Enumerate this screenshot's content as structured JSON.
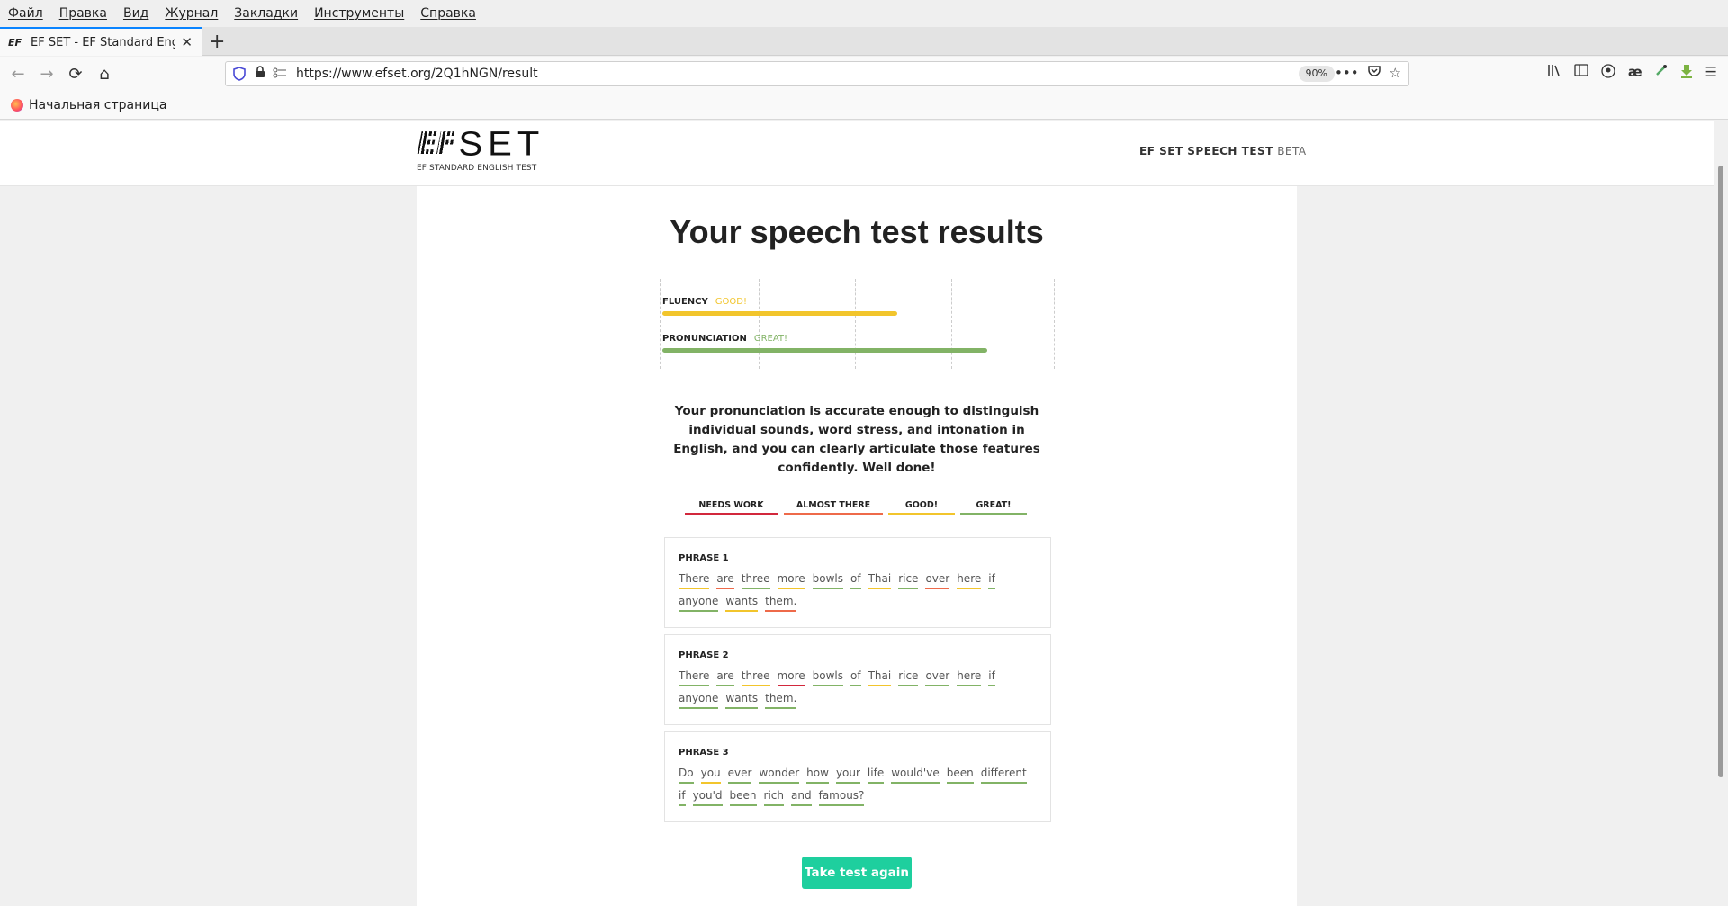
{
  "menu": [
    "Файл",
    "Правка",
    "Вид",
    "Журнал",
    "Закладки",
    "Инструменты",
    "Справка"
  ],
  "tab": {
    "favicon": "EF",
    "title": "EF SET - EF Standard Englis",
    "close": "✕",
    "new_tab": "+"
  },
  "nav": {
    "back": "←",
    "forward": "→",
    "reload": "⟳",
    "home": "⌂"
  },
  "url": {
    "value": "https://www.efset.org/2Q1hNGN/result",
    "zoom": "90%"
  },
  "bookmarks": {
    "item": "Начальная страница"
  },
  "header": {
    "logo_letters": "EF",
    "logo_word": "SET",
    "logo_subtitle": "EF STANDARD ENGLISH TEST",
    "right_strong": "EF SET SPEECH TEST",
    "right_beta": "BETA"
  },
  "page_title": "Your speech test results",
  "metrics": [
    {
      "label": "FLUENCY",
      "rating": "GOOD!",
      "color": "#f2c52c",
      "score": 0.6
    },
    {
      "label": "PRONUNCIATION",
      "rating": "GREAT!",
      "color": "#82b366",
      "score": 0.83
    }
  ],
  "summary": "Your pronunciation is accurate enough to distinguish individual sounds, word stress, and intonation in English, and you can clearly articulate those features confidently. Well done!",
  "legend": [
    {
      "label": "NEEDS WORK",
      "color": "#d2283c"
    },
    {
      "label": "ALMOST THERE",
      "color": "#ee6a4a"
    },
    {
      "label": "GOOD!",
      "color": "#f2c52c"
    },
    {
      "label": "GREAT!",
      "color": "#82b366"
    }
  ],
  "phrases": [
    {
      "title": "PHRASE 1",
      "words": [
        {
          "text": "There",
          "color": "#f2c52c"
        },
        {
          "text": "are",
          "color": "#ee6a4a"
        },
        {
          "text": "three",
          "color": "#82b366"
        },
        {
          "text": "more",
          "color": "#f2c52c"
        },
        {
          "text": "bowls",
          "color": "#82b366"
        },
        {
          "text": "of",
          "color": "#82b366"
        },
        {
          "text": "Thai",
          "color": "#f2c52c"
        },
        {
          "text": "rice",
          "color": "#82b366"
        },
        {
          "text": "over",
          "color": "#ee6a4a"
        },
        {
          "text": "here",
          "color": "#f2c52c"
        },
        {
          "text": "if",
          "color": "#82b366"
        },
        {
          "text": "anyone",
          "color": "#82b366"
        },
        {
          "text": "wants",
          "color": "#f2c52c"
        },
        {
          "text": "them.",
          "color": "#ee6a4a"
        }
      ]
    },
    {
      "title": "PHRASE 2",
      "words": [
        {
          "text": "There",
          "color": "#82b366"
        },
        {
          "text": "are",
          "color": "#82b366"
        },
        {
          "text": "three",
          "color": "#f2c52c"
        },
        {
          "text": "more",
          "color": "#d2283c"
        },
        {
          "text": "bowls",
          "color": "#82b366"
        },
        {
          "text": "of",
          "color": "#82b366"
        },
        {
          "text": "Thai",
          "color": "#f2c52c"
        },
        {
          "text": "rice",
          "color": "#82b366"
        },
        {
          "text": "over",
          "color": "#82b366"
        },
        {
          "text": "here",
          "color": "#82b366"
        },
        {
          "text": "if",
          "color": "#82b366"
        },
        {
          "text": "anyone",
          "color": "#82b366"
        },
        {
          "text": "wants",
          "color": "#82b366"
        },
        {
          "text": "them.",
          "color": "#82b366"
        }
      ]
    },
    {
      "title": "PHRASE 3",
      "words": [
        {
          "text": "Do",
          "color": "#82b366"
        },
        {
          "text": "you",
          "color": "#f2c52c"
        },
        {
          "text": "ever",
          "color": "#82b366"
        },
        {
          "text": "wonder",
          "color": "#82b366"
        },
        {
          "text": "how",
          "color": "#82b366"
        },
        {
          "text": "your",
          "color": "#82b366"
        },
        {
          "text": "life",
          "color": "#82b366"
        },
        {
          "text": "would've",
          "color": "#82b366"
        },
        {
          "text": "been",
          "color": "#82b366"
        },
        {
          "text": "different",
          "color": "#82b366"
        },
        {
          "text": "if",
          "color": "#82b366"
        },
        {
          "text": "you'd",
          "color": "#82b366"
        },
        {
          "text": "been",
          "color": "#82b366"
        },
        {
          "text": "rich",
          "color": "#82b366"
        },
        {
          "text": "and",
          "color": "#82b366"
        },
        {
          "text": "famous?",
          "color": "#82b366"
        }
      ]
    }
  ],
  "cta": "Take test again"
}
